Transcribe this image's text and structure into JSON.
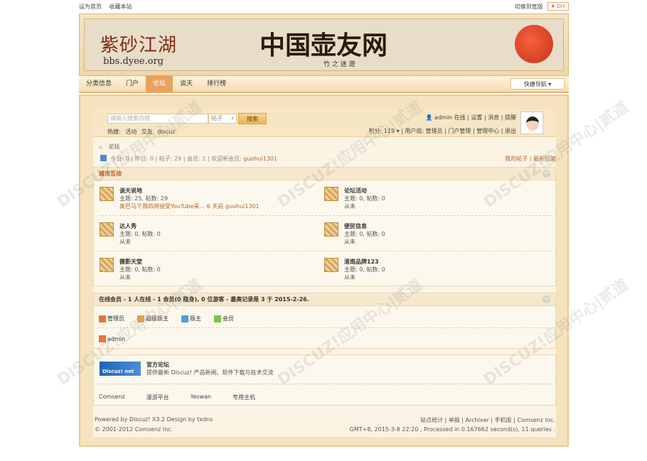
{
  "topbar": {
    "set_home": "设为首页",
    "favorite": "收藏本站",
    "switch_wide": "切换到宽版",
    "diy": "♦ DIY"
  },
  "banner": {
    "logo_cn": "紫砂江湖",
    "logo_url": "bbs.dyee.org",
    "title": "中国壶友网",
    "subtitle": "竹 之 迷 遊"
  },
  "nav": {
    "items": [
      "分类信息",
      "门户",
      "论坛",
      "谈天",
      "排行榜"
    ],
    "quicknav": "快捷导航 ▾"
  },
  "search": {
    "placeholder": "请输入搜索内容",
    "type": "帖子",
    "button": "搜索",
    "hot_label": "热搜:",
    "hot_terms": [
      "活动",
      "交友",
      "discuz"
    ]
  },
  "user": {
    "line1": "admin 在线 | 设置 | 消息 | 提醒",
    "line2": "积分: 119 ▾  |  用户组: 管理员 | 门户管理 | 管理中心 | 退出"
  },
  "breadcrumb": "论坛",
  "stats": {
    "text": "今日: 0 | 昨日: 0 | 帖子: 29 | 会员: 2 | 欢迎新会员:",
    "new_member": "guohui1301",
    "right_links": "我的帖子 | 最新回复"
  },
  "group": {
    "title": "城市互动",
    "collapse": "−",
    "forums": [
      {
        "name": "谈天说地",
        "count": "主题: 25, 帖数: 29",
        "last": "奥巴马下周四将接受YouTube采... 6 天前 guohui1301",
        "is_link": true
      },
      {
        "name": "论坛活动",
        "count": "主题: 0, 帖数: 0",
        "last": "从未",
        "is_link": false
      },
      {
        "name": "达人秀",
        "count": "主题: 0, 帖数: 0",
        "last": "从未",
        "is_link": false
      },
      {
        "name": "便民信息",
        "count": "主题: 0, 帖数: 0",
        "last": "从未",
        "is_link": false
      },
      {
        "name": "摄影天堂",
        "count": "主题: 0, 帖数: 0",
        "last": "从未",
        "is_link": false
      },
      {
        "name": "淮南品牌123",
        "count": "主题: 0, 帖数: 0",
        "last": "从未",
        "is_link": false
      }
    ]
  },
  "online": {
    "title": "在线会员 - 1 人在线 - 1 会员(0 隐身), 0 位游客 - 最高记录是 3 于 2015-2-26.",
    "legend": [
      {
        "label": "管理员",
        "color": "#e8733a"
      },
      {
        "label": "超级版主",
        "color": "#e8a34a"
      },
      {
        "label": "版主",
        "color": "#4aa0d8"
      },
      {
        "label": "会员",
        "color": "#7cc24a"
      }
    ],
    "users": [
      "admin"
    ]
  },
  "partner": {
    "logo": "Discuz! net",
    "name": "官方论坛",
    "desc": "提供最新 Discuz! 产品新闻、软件下载与技术交流",
    "links": [
      "Comsenz",
      "漫游平台",
      "Yeswan",
      "专用主机"
    ]
  },
  "footer": {
    "powered": "Powered by Discuz! X3.2 Design by txdns",
    "copyright": "© 2001-2012 Comsenz Inc.",
    "links": "站点统计 | 举报 | Archiver | 手机版 | Comsenz Inc.",
    "timing": "GMT+8, 2015-3-8 22:20 , Processed in 0.167662 second(s), 11 queries ."
  },
  "watermark": "DISCUZ!应用中心|贰道"
}
